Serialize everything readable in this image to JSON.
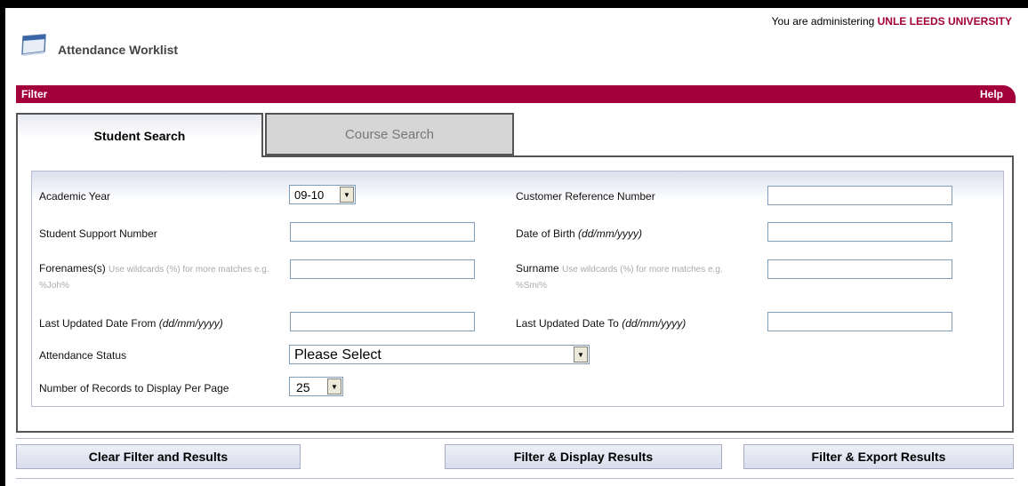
{
  "admin": {
    "prefix": "You are administering",
    "org": "UNLE LEEDS UNIVERSITY"
  },
  "header": {
    "title": "Attendance Worklist",
    "icon": "card-icon"
  },
  "filter_bar": {
    "label": "Filter",
    "help": "Help"
  },
  "tabs": [
    {
      "label": "Student Search",
      "active": true
    },
    {
      "label": "Course Search",
      "active": false
    }
  ],
  "form": {
    "academic_year": {
      "label": "Academic Year",
      "value": "09-10"
    },
    "customer_reference": {
      "label": "Customer Reference Number",
      "value": ""
    },
    "student_support": {
      "label": "Student Support Number",
      "value": ""
    },
    "dob": {
      "label": "Date of Birth",
      "format": "(dd/mm/yyyy)",
      "value": ""
    },
    "forenames": {
      "label": "Forenames(s)",
      "hint": "Use wildcards (%) for more matches e.g. %Joh%",
      "value": ""
    },
    "surname": {
      "label": "Surname",
      "hint": "Use wildcards (%) for more matches e.g. %Smi%",
      "value": ""
    },
    "updated_from": {
      "label": "Last Updated Date From",
      "format": "(dd/mm/yyyy)",
      "value": ""
    },
    "updated_to": {
      "label": "Last Updated Date To",
      "format": "(dd/mm/yyyy)",
      "value": ""
    },
    "attendance_status": {
      "label": "Attendance Status",
      "value": "Please Select"
    },
    "records_per_page": {
      "label": "Number of Records to Display Per Page",
      "value": "25"
    }
  },
  "buttons": {
    "clear": "Clear Filter and Results",
    "display": "Filter & Display Results",
    "export": "Filter & Export Results"
  },
  "colors": {
    "brand": "#a3003b",
    "tab_inactive": "#d6d6d6",
    "button_border": "#a9adc5"
  }
}
